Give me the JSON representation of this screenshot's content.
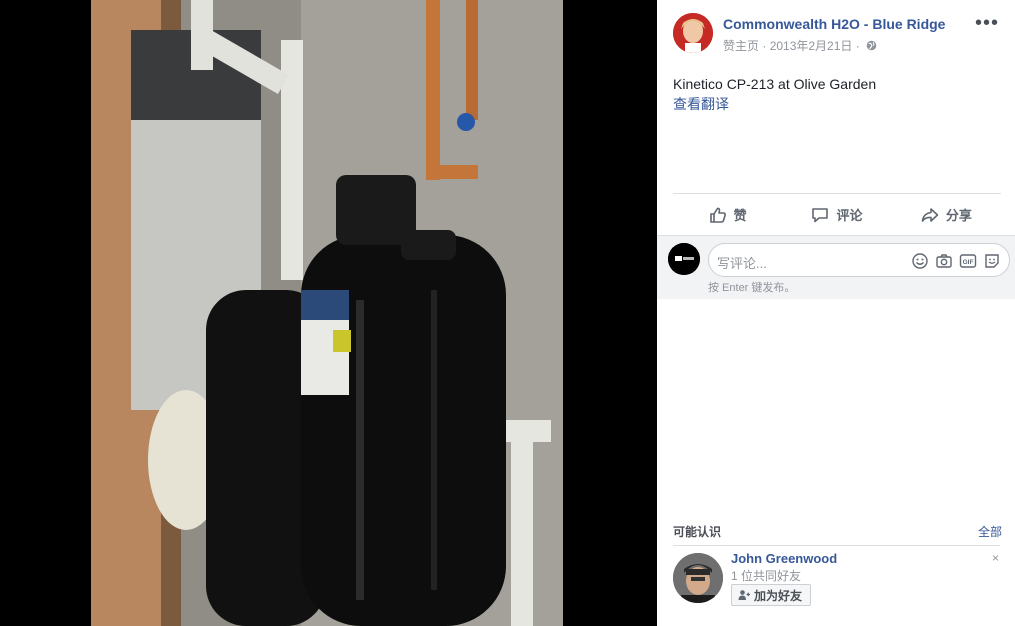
{
  "post": {
    "page_name": "Commonwealth H2O - Blue Ridge",
    "like_page": "赞主页",
    "separator": " · ",
    "date": "2013年2月21日",
    "separator2": " · ",
    "more": "•••",
    "caption": "Kinetico CP-213 at Olive Garden",
    "translate": "查看翻译"
  },
  "actions": {
    "like": "赞",
    "comment": "评论",
    "share": "分享"
  },
  "comment_box": {
    "placeholder": "写评论...",
    "hint": "按 Enter 键发布。",
    "icons": [
      "emoji-icon",
      "camera-icon",
      "gif-icon",
      "sticker-icon"
    ]
  },
  "pymk": {
    "title": "可能认识",
    "see_all": "全部",
    "friend": {
      "name": "John Greenwood",
      "mutual": "1 位共同好友",
      "add_button": "加为好友",
      "dismiss": "×"
    }
  },
  "photo": {
    "description_colors": {
      "tank": "#0c0c0c",
      "wall": "#9a9890",
      "pipe": "#c77a3b"
    }
  }
}
